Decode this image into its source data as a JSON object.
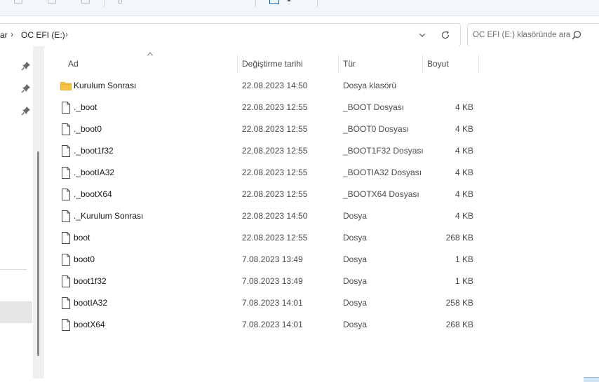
{
  "breadcrumb": {
    "partial": "ar",
    "current": "OC EFI (E:)"
  },
  "search": {
    "placeholder": "OC EFI (E:) klasöründe ara"
  },
  "columns": {
    "name": "Ad",
    "date": "Değiştirme tarihi",
    "type": "Tür",
    "size": "Boyut"
  },
  "files": [
    {
      "name": "Kurulum Sonrası",
      "date": "22.08.2023 14:50",
      "type": "Dosya klasörü",
      "size": "",
      "icon": "folder-icon"
    },
    {
      "name": "._boot",
      "date": "22.08.2023 12:55",
      "type": "_BOOT Dosyası",
      "size": "4 KB",
      "icon": "file-icon"
    },
    {
      "name": "._boot0",
      "date": "22.08.2023 12:55",
      "type": "_BOOT0 Dosyası",
      "size": "4 KB",
      "icon": "file-icon"
    },
    {
      "name": "._boot1f32",
      "date": "22.08.2023 12:55",
      "type": "_BOOT1F32 Dosyası",
      "size": "4 KB",
      "icon": "file-icon"
    },
    {
      "name": "._bootIA32",
      "date": "22.08.2023 12:55",
      "type": "_BOOTIA32 Dosyası",
      "size": "4 KB",
      "icon": "file-icon"
    },
    {
      "name": "._bootX64",
      "date": "22.08.2023 12:55",
      "type": "_BOOTX64 Dosyası",
      "size": "4 KB",
      "icon": "file-icon"
    },
    {
      "name": "._Kurulum Sonrası",
      "date": "22.08.2023 14:50",
      "type": "Dosya",
      "size": "4 KB",
      "icon": "file-icon"
    },
    {
      "name": "boot",
      "date": "22.08.2023 12:55",
      "type": "Dosya",
      "size": "268 KB",
      "icon": "file-icon"
    },
    {
      "name": "boot0",
      "date": "7.08.2023 13:49",
      "type": "Dosya",
      "size": "1 KB",
      "icon": "file-icon"
    },
    {
      "name": "boot1f32",
      "date": "7.08.2023 13:49",
      "type": "Dosya",
      "size": "1 KB",
      "icon": "file-icon"
    },
    {
      "name": "bootIA32",
      "date": "7.08.2023 14:01",
      "type": "Dosya",
      "size": "258 KB",
      "icon": "file-icon"
    },
    {
      "name": "bootX64",
      "date": "7.08.2023 14:01",
      "type": "Dosya",
      "size": "268 KB",
      "icon": "file-icon"
    }
  ],
  "colors": {
    "accent": "#0067c0",
    "folder": "#f5c542",
    "selection": "#e5e5e5"
  }
}
